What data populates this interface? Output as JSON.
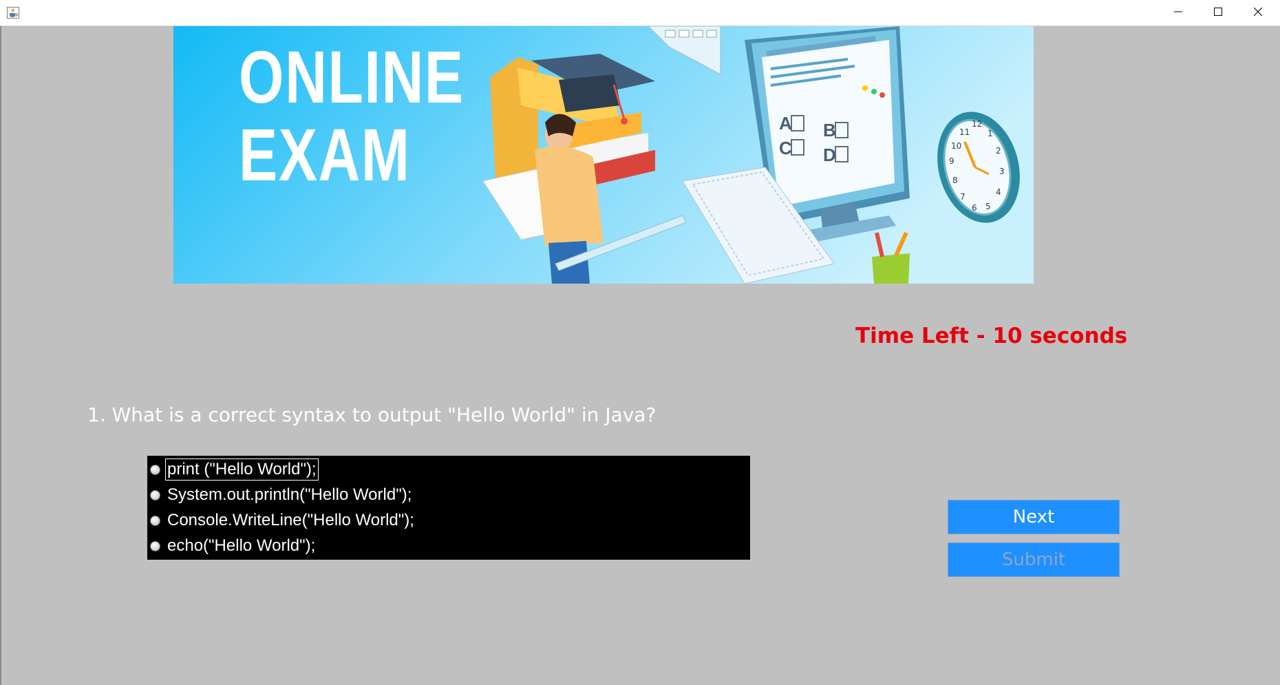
{
  "window": {
    "icon": "java-coffee-icon",
    "controls": [
      "minimize-icon",
      "maximize-icon",
      "close-icon"
    ]
  },
  "banner": {
    "line1": "ONLINE",
    "line2": "EXAM",
    "clock_numbers": [
      "12",
      "1",
      "2",
      "3",
      "4",
      "5",
      "6",
      "7",
      "8",
      "9",
      "10",
      "11"
    ],
    "screen_letters": [
      "A",
      "B",
      "C",
      "D"
    ]
  },
  "timer": {
    "text": "Time Left - 10 seconds",
    "color": "#e8000b"
  },
  "question": {
    "text": "1. What is a correct syntax to output \"Hello World\" in Java?"
  },
  "options": [
    {
      "label": "print (\"Hello World\");",
      "focused": true
    },
    {
      "label": "System.out.println(\"Hello World\");",
      "focused": false
    },
    {
      "label": "Console.WriteLine(\"Hello World\");",
      "focused": false
    },
    {
      "label": "echo(\"Hello World\");",
      "focused": false
    }
  ],
  "buttons": {
    "next": "Next",
    "submit": "Submit",
    "submit_enabled": false,
    "accent": "#1e90ff"
  }
}
